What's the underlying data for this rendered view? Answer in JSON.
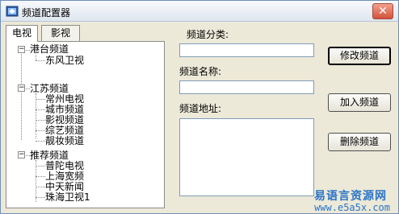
{
  "window": {
    "title": "频道配置器",
    "close_glyph": "✕",
    "icon": "app-icon"
  },
  "tabs": [
    {
      "label": "电视",
      "active": true
    },
    {
      "label": "影视",
      "active": false
    }
  ],
  "tree": [
    {
      "label": "港台频道",
      "expanded": true,
      "expander": "−",
      "children": [
        "东风卫视"
      ]
    },
    {
      "label": "江苏频道",
      "expanded": true,
      "expander": "−",
      "children": [
        "常州电视",
        "城市频道",
        "影视频道",
        "综艺频道",
        "靓妆频道"
      ]
    },
    {
      "label": "推荐频道",
      "expanded": true,
      "expander": "−",
      "children": [
        "普陀电视",
        "上海宽频",
        "中天新闻",
        "珠海卫视1"
      ]
    }
  ],
  "form": {
    "category_label": "频道分类:",
    "category_value": "",
    "name_label": "频道名称:",
    "name_value": "",
    "address_label": "频道地址:",
    "address_value": ""
  },
  "buttons": {
    "modify": "修改频道",
    "add": "加入频道",
    "delete": "删除频道"
  },
  "watermark": {
    "text": "易语言资源网",
    "url": "www.e5a5x.com"
  },
  "colors": {
    "window_bg": "#ece9d8",
    "close_button": "#d3523a",
    "watermark": "#2a74c8"
  }
}
